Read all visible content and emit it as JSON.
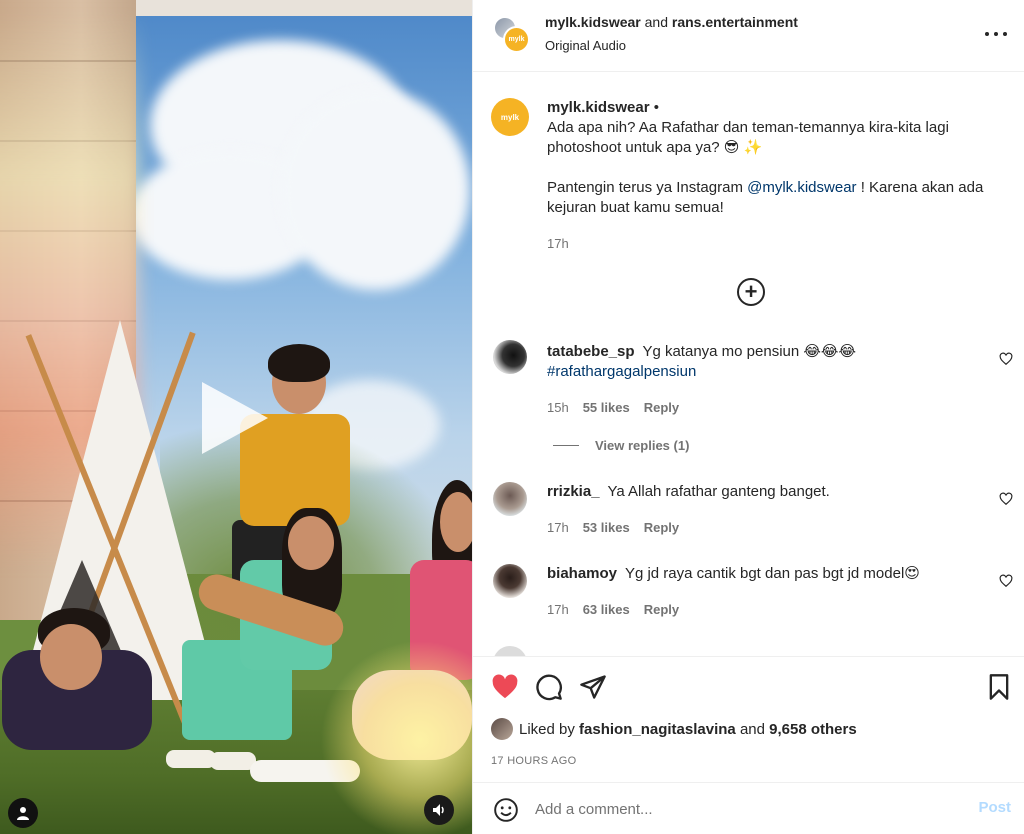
{
  "post": {
    "header": {
      "author": "mylk.kidswear",
      "and_text": "and",
      "collaborator": "rans.entertainment",
      "audio": "Original Audio",
      "brand_avatar_text": "mylk"
    },
    "caption": {
      "username": "mylk.kidswear",
      "verified_dot": "•",
      "line1": "Ada apa nih? Aa Rafathar dan teman-temannya kira-kita lagi photoshoot untuk apa ya? 😎 ✨",
      "line2_before": "Pantengin terus ya Instagram ",
      "mention": "@mylk.kidswear",
      "line2_after": " ! Karena akan ada kejuran buat kamu semua!",
      "time": "17h"
    },
    "comments": [
      {
        "username": "tatabebe_sp",
        "text": "Yg katanya mo pensiun 😂😂😂",
        "hashtag": "#rafathargagalpensiun",
        "time": "15h",
        "likes": "55 likes",
        "reply": "Reply",
        "view_replies": "View replies (1)"
      },
      {
        "username": "rrizkia_",
        "text": "Ya Allah rafathar ganteng banget.",
        "time": "17h",
        "likes": "53 likes",
        "reply": "Reply"
      },
      {
        "username": "biahamoy",
        "text": "Yg jd raya cantik bgt dan pas bgt jd model😍",
        "time": "17h",
        "likes": "63 likes",
        "reply": "Reply"
      }
    ],
    "likes": {
      "prefix": "Liked by ",
      "user": "fashion_nagitaslavina",
      "middle": " and ",
      "others": "9,658 others"
    },
    "time_ago": "17 HOURS AGO",
    "add_comment": {
      "placeholder": "Add a comment...",
      "post_label": "Post"
    }
  },
  "colors": {
    "like_red": "#ed4956",
    "link_blue": "#00376b",
    "post_disabled": "#b3dbff",
    "brand_yellow": "#f5b324"
  }
}
